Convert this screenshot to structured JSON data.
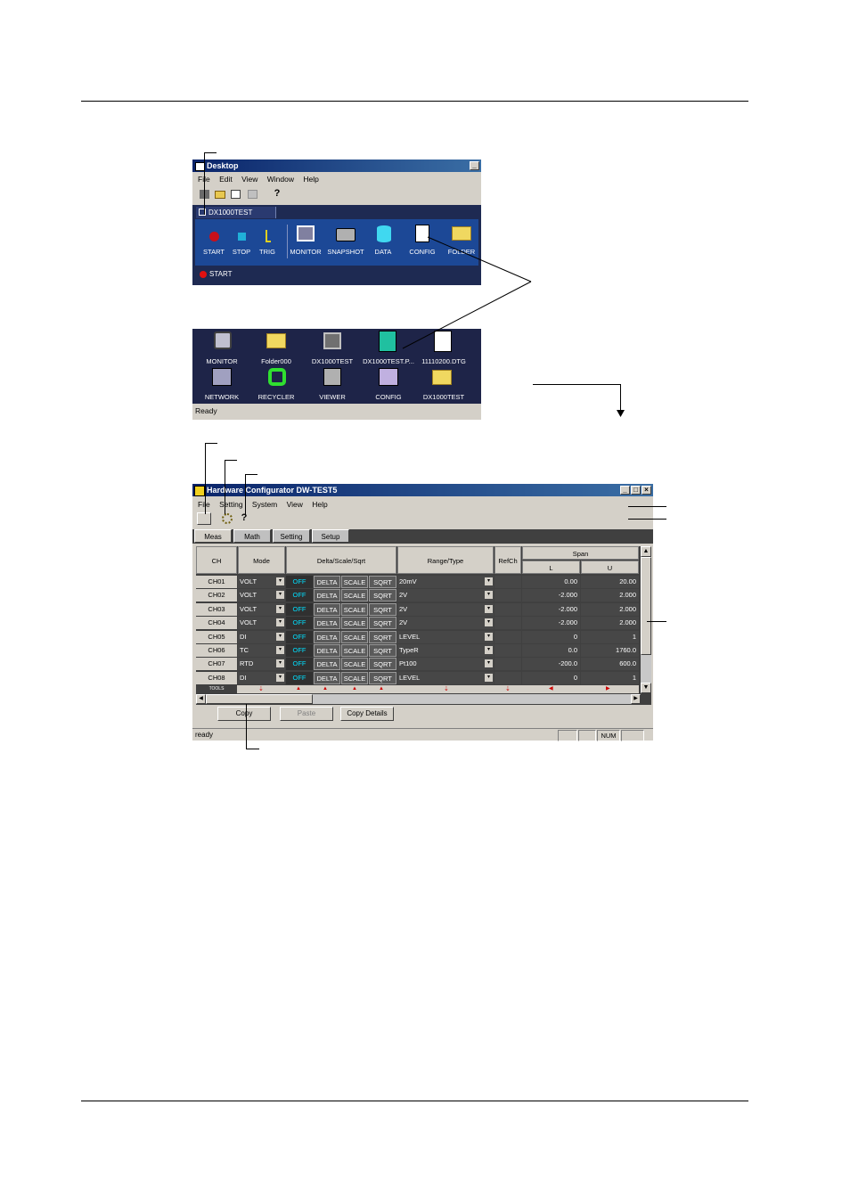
{
  "desktop": {
    "title": "Desktop",
    "menu": [
      "File",
      "Edit",
      "View",
      "Window",
      "Help"
    ],
    "tab_label": "DX1000TEST",
    "tools": [
      {
        "label": "START",
        "icon": "record-dot-icon"
      },
      {
        "label": "STOP",
        "icon": "stop-square-icon"
      },
      {
        "label": "TRIG",
        "icon": "trigger-icon"
      },
      {
        "label": "MONITOR",
        "icon": "monitor-icon"
      },
      {
        "label": "SNAPSHOT",
        "icon": "camera-icon"
      },
      {
        "label": "DATA",
        "icon": "data-cylinder-icon"
      },
      {
        "label": "CONFIG",
        "icon": "config-icon"
      },
      {
        "label": "FOLDER",
        "icon": "folder-icon"
      }
    ],
    "status": "START",
    "files_row1": [
      "MONITOR",
      "Folder000",
      "DX1000TEST",
      "DX1000TEST.P...",
      "11110200.DTG"
    ],
    "files_row2": [
      "NETWORK",
      "RECYCLER",
      "VIEWER",
      "CONFIG",
      "DX1000TEST"
    ],
    "statusbar": "Ready"
  },
  "hwconfig": {
    "title": "Hardware Configurator DW-TEST5",
    "menu": [
      "File",
      "Setting",
      "System",
      "View",
      "Help"
    ],
    "tabs": [
      "Meas",
      "Math",
      "Setting",
      "Setup"
    ],
    "headers": {
      "ch": "CH",
      "mode": "Mode",
      "dss": "Delta/Scale/Sqrt",
      "range": "Range/Type",
      "refch": "RefCh",
      "span": "Span",
      "l": "L",
      "u": "U"
    },
    "rows": [
      {
        "ch": "CH01",
        "mode": "VOLT",
        "off": "OFF",
        "delta": "DELTA",
        "scale": "SCALE",
        "sqrt": "SQRT",
        "range": "20mV",
        "l": "0.00",
        "u": "20.00"
      },
      {
        "ch": "CH02",
        "mode": "VOLT",
        "off": "OFF",
        "delta": "DELTA",
        "scale": "SCALE",
        "sqrt": "SQRT",
        "range": "2V",
        "l": "-2.000",
        "u": "2.000"
      },
      {
        "ch": "CH03",
        "mode": "VOLT",
        "off": "OFF",
        "delta": "DELTA",
        "scale": "SCALE",
        "sqrt": "SQRT",
        "range": "2V",
        "l": "-2.000",
        "u": "2.000"
      },
      {
        "ch": "CH04",
        "mode": "VOLT",
        "off": "OFF",
        "delta": "DELTA",
        "scale": "SCALE",
        "sqrt": "SQRT",
        "range": "2V",
        "l": "-2.000",
        "u": "2.000"
      },
      {
        "ch": "CH05",
        "mode": "DI",
        "off": "OFF",
        "delta": "DELTA",
        "scale": "SCALE",
        "sqrt": "SQRT",
        "range": "LEVEL",
        "l": "0",
        "u": "1"
      },
      {
        "ch": "CH06",
        "mode": "TC",
        "off": "OFF",
        "delta": "DELTA",
        "scale": "SCALE",
        "sqrt": "SQRT",
        "range": "TypeR",
        "l": "0.0",
        "u": "1760.0"
      },
      {
        "ch": "CH07",
        "mode": "RTD",
        "off": "OFF",
        "delta": "DELTA",
        "scale": "SCALE",
        "sqrt": "SQRT",
        "range": "Pt100",
        "l": "-200.0",
        "u": "600.0"
      },
      {
        "ch": "CH08",
        "mode": "DI",
        "off": "OFF",
        "delta": "DELTA",
        "scale": "SCALE",
        "sqrt": "SQRT",
        "range": "LEVEL",
        "l": "0",
        "u": "1"
      }
    ],
    "tools_label": "TOOLS",
    "buttons": {
      "copy": "Copy",
      "paste": "Paste",
      "copy_details": "Copy Details"
    },
    "status": "ready",
    "num": "NUM"
  }
}
